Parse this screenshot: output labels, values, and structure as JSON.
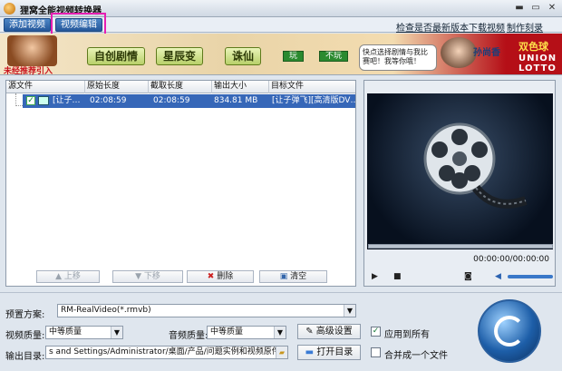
{
  "window": {
    "title": "狸窝全能视频转换器",
    "min": "▬",
    "max": "▭",
    "close": "✕"
  },
  "toolbar": {
    "add_video": "添加视频",
    "edit_video": "视频编辑",
    "links": [
      "检查是否最新版本",
      "下载视频",
      "制作刻录DVD"
    ]
  },
  "banner": {
    "tabs": [
      "自创剧情",
      "星辰变",
      "诛仙"
    ],
    "green1": "玩",
    "green2": "不玩",
    "caption": "未经推荐引入",
    "bubble": "快点选择剧情与我比赛吧！我等你哦！",
    "name": "孙尚香",
    "logo1": "双色球",
    "logo2": "UNION LOTTO"
  },
  "filelist": {
    "columns": [
      "源文件",
      "原始长度",
      "截取长度",
      "输出大小",
      "目标文件"
    ],
    "rows": [
      {
        "checked": "✓",
        "source": "[让子…",
        "original": "02:08:59",
        "cut": "02:08:59",
        "size": "834.81 MB",
        "target": "[让子弹飞][高清版DV…"
      }
    ],
    "up": "上移",
    "down": "下移",
    "delete": "删除",
    "clear": "清空",
    "up_icon": "arrow-up-icon",
    "down_icon": "arrow-down-icon",
    "delete_icon": "cross-icon",
    "clear_icon": "eraser-icon"
  },
  "preview": {
    "time": "00:00:00/00:00:00",
    "play": "▶",
    "stop": "■",
    "camera": "◙",
    "vol_icon": "◀"
  },
  "settings": {
    "preset_label": "预置方案:",
    "preset_value": "RM-RealVideo(*.rmvb)",
    "video_quality_label": "视频质量:",
    "video_quality_value": "中等质量",
    "audio_quality_label": "音频质量:",
    "audio_quality_value": "中等质量",
    "advanced": "高级设置",
    "apply_all": "应用到所有",
    "apply_checked": "✓",
    "output_label": "输出目录:",
    "output_value": "s and Settings/Administrator/桌面/产品/问题实例和视频原件/转换",
    "open_dir": "打开目录",
    "merge": "合并成一个文件",
    "merge_checked": ""
  }
}
